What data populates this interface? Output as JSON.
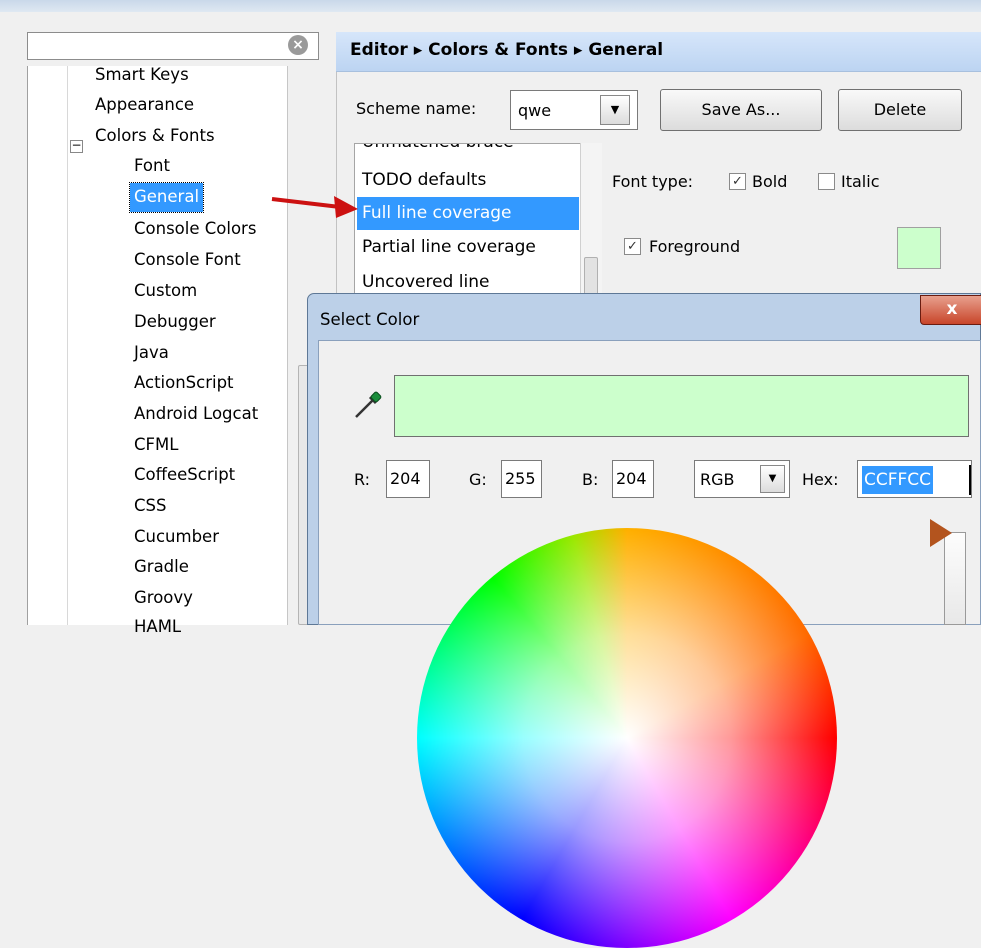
{
  "tree": {
    "items": [
      {
        "label": "Smart Keys"
      },
      {
        "label": "Appearance"
      },
      {
        "label": "Colors & Fonts"
      },
      {
        "label": "Font"
      },
      {
        "label": "General"
      },
      {
        "label": "Console Colors"
      },
      {
        "label": "Console Font"
      },
      {
        "label": "Custom"
      },
      {
        "label": "Debugger"
      },
      {
        "label": "Java"
      },
      {
        "label": "ActionScript"
      },
      {
        "label": "Android Logcat"
      },
      {
        "label": "CFML"
      },
      {
        "label": "CoffeeScript"
      },
      {
        "label": "CSS"
      },
      {
        "label": "Cucumber"
      },
      {
        "label": "Gradle"
      },
      {
        "label": "Groovy"
      },
      {
        "label": "HAML"
      }
    ],
    "collapse_symbol": "−",
    "clear_symbol": "×"
  },
  "breadcrumb": "Editor ▸ Colors & Fonts ▸ General",
  "scheme": {
    "label": "Scheme name:",
    "value": "qwe",
    "save_as": "Save As...",
    "delete": "Delete"
  },
  "attributes": {
    "items": [
      "Unmatched brace",
      "TODO defaults",
      "Full line coverage",
      "Partial line coverage",
      "Uncovered line"
    ]
  },
  "font_type": {
    "label": "Font type:",
    "bold": "Bold",
    "italic": "Italic",
    "check": "✓"
  },
  "foreground": {
    "label": "Foreground",
    "color": "#CCFFCC"
  },
  "dialog": {
    "title": "Select Color",
    "close": "x",
    "r_label": "R:",
    "r": "204",
    "g_label": "G:",
    "g": "255",
    "b_label": "B:",
    "b": "204",
    "mode": "RGB",
    "hex_label": "Hex:",
    "hex": "CCFFCC",
    "dropdown_arrow": "▼",
    "preview_color": "#CCFFCC"
  },
  "colors": {
    "selection": "#3399ff",
    "arrow": "#cc1111",
    "marker": "#b3541e"
  },
  "icons": {
    "picker": "eyedropper-icon",
    "arrow": "red-pointer-arrow-icon"
  }
}
